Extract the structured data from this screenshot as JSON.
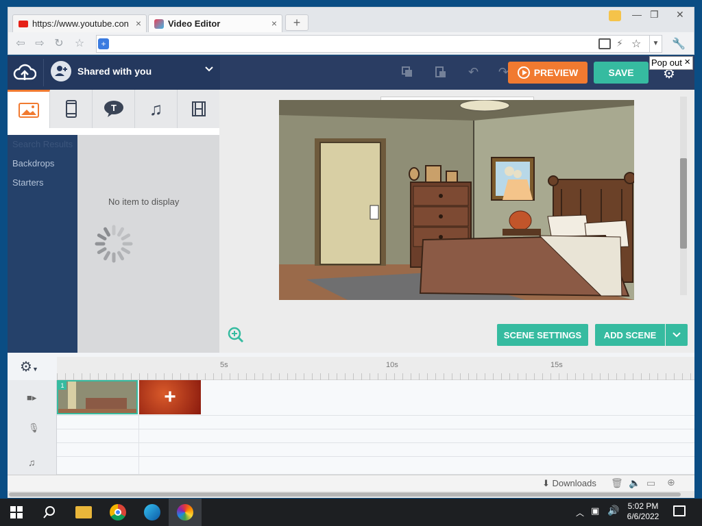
{
  "browser": {
    "tabs": [
      {
        "title": "https://www.youtube.con",
        "close": "×"
      },
      {
        "title": "Video Editor",
        "close": "×"
      }
    ],
    "new_tab": "+",
    "window_controls": {
      "minimize": "—",
      "restore": "❐",
      "close": "✕"
    }
  },
  "app": {
    "account": "Shared with you",
    "preview": "PREVIEW",
    "save": "SAVE",
    "popout": "Pop out",
    "popout_close": "×"
  },
  "sidebar": {
    "nav": [
      "Search Results",
      "Backdrops",
      "Starters"
    ],
    "empty": "No item to display"
  },
  "stage": {
    "scene_settings": "SCENE SETTINGS",
    "add_scene": "ADD SCENE"
  },
  "timeline": {
    "ticks": [
      "5s",
      "10s",
      "15s"
    ],
    "scene_number": "1",
    "add_glyph": "+"
  },
  "statusbar": {
    "downloads": "Downloads"
  },
  "taskbar": {
    "time": "5:02 PM",
    "date": "6/6/2022"
  },
  "colors": {
    "accent_orange": "#f17a30",
    "accent_teal": "#36bba0",
    "header_navy": "#2a3d63",
    "nav_blue": "#25416a"
  }
}
